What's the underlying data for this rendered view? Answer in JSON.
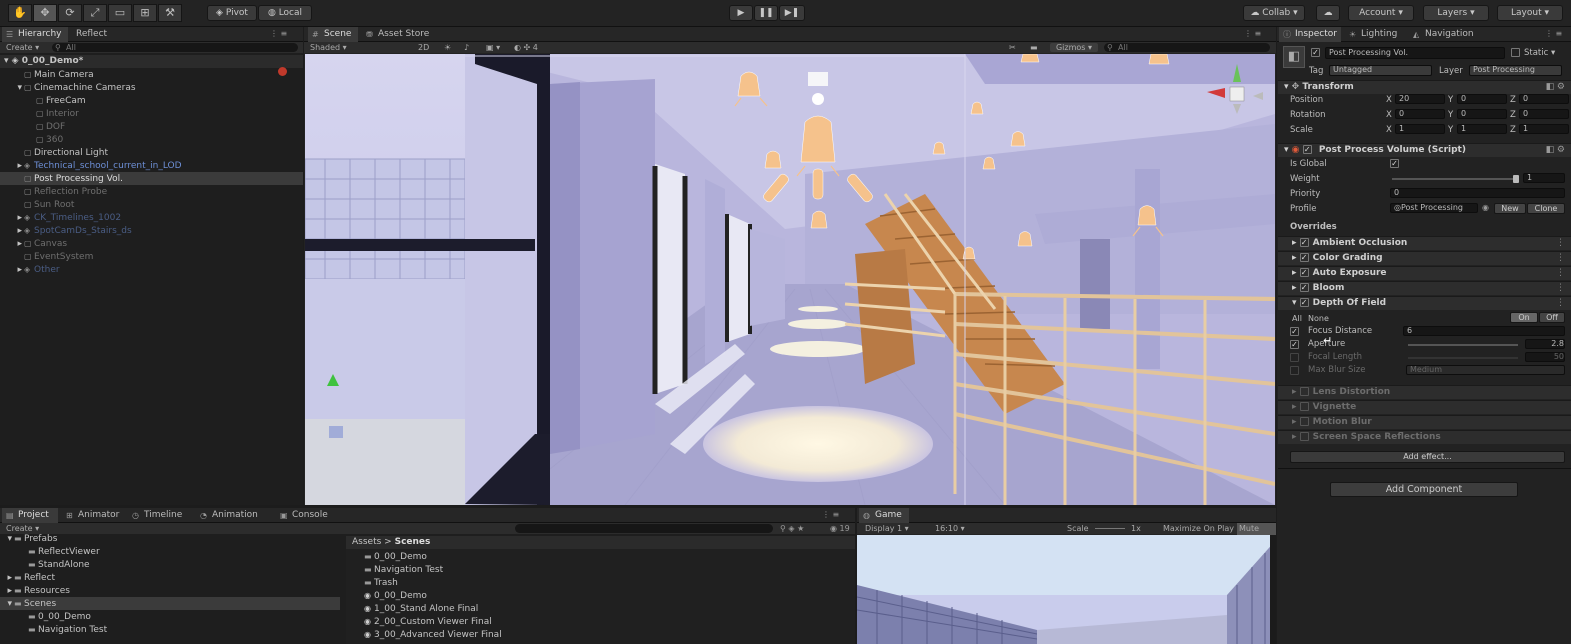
{
  "toolbar": {
    "tools": [
      "hand-tool",
      "move-tool",
      "rotate-tool",
      "scale-tool",
      "rect-tool",
      "transform-tool",
      "custom-tool"
    ],
    "pivot_label": "Pivot",
    "local_label": "Local",
    "play_icon": "▶",
    "pause_icon": "❚❚",
    "step_icon": "▶❚",
    "collab_label": "Collab",
    "account_label": "Account",
    "layers_label": "Layers",
    "layout_label": "Layout"
  },
  "hierarchy": {
    "tabs": [
      "Hierarchy",
      "Reflect"
    ],
    "create_label": "Create",
    "search_placeholder": "All",
    "scene_name": "0_00_Demo*",
    "items": [
      {
        "label": "Main Camera",
        "style": "normal",
        "indent": 2
      },
      {
        "label": "Cinemachine Cameras",
        "style": "normal",
        "indent": 2
      },
      {
        "label": "FreeCam",
        "style": "normal",
        "indent": 3
      },
      {
        "label": "Interior",
        "style": "dim",
        "indent": 3
      },
      {
        "label": "DOF",
        "style": "dim",
        "indent": 3
      },
      {
        "label": "360",
        "style": "dim",
        "indent": 3
      },
      {
        "label": "Directional Light",
        "style": "normal",
        "indent": 2
      },
      {
        "label": "Technical_school_current_in_LOD",
        "style": "blue",
        "indent": 2
      },
      {
        "label": "Post Processing Vol.",
        "style": "selected",
        "indent": 2
      },
      {
        "label": "Reflection Probe",
        "style": "dim",
        "indent": 2
      },
      {
        "label": "Sun Root",
        "style": "dim",
        "indent": 2
      },
      {
        "label": "CK_Timelines_1002",
        "style": "dimblue",
        "indent": 2
      },
      {
        "label": "SpotCamDs_Stairs_ds",
        "style": "dimblue",
        "indent": 2
      },
      {
        "label": "Canvas",
        "style": "dim",
        "indent": 2
      },
      {
        "label": "EventSystem",
        "style": "dim",
        "indent": 2
      },
      {
        "label": "Other",
        "style": "dimblue",
        "indent": 2
      }
    ]
  },
  "scene_view": {
    "tabs": [
      "Scene",
      "Asset Store"
    ],
    "shading_mode": "Shaded",
    "mode_2d": "2D",
    "gizmos_label": "Gizmos",
    "search_placeholder": "All"
  },
  "inspector": {
    "tabs": [
      "Inspector",
      "Lighting",
      "Navigation"
    ],
    "object_name": "Post Processing Vol.",
    "static_label": "Static",
    "tag_label": "Tag",
    "tag_value": "Untagged",
    "layer_label": "Layer",
    "layer_value": "Post Processing",
    "transform": {
      "title": "Transform",
      "rows": [
        {
          "label": "Position",
          "x": "20",
          "y": "0",
          "z": "0"
        },
        {
          "label": "Rotation",
          "x": "0",
          "y": "0",
          "z": "0"
        },
        {
          "label": "Scale",
          "x": "1",
          "y": "1",
          "z": "1"
        }
      ]
    },
    "ppv": {
      "title": "Post Process Volume (Script)",
      "is_global_label": "Is Global",
      "weight_label": "Weight",
      "weight_value": "1",
      "priority_label": "Priority",
      "priority_value": "0",
      "profile_label": "Profile",
      "profile_value": "Post Processing",
      "new_label": "New",
      "clone_label": "Clone",
      "overrides_label": "Overrides"
    },
    "effects": [
      {
        "label": "Ambient Occlusion",
        "enabled": true,
        "open": false
      },
      {
        "label": "Color Grading",
        "enabled": true,
        "open": false
      },
      {
        "label": "Auto Exposure",
        "enabled": true,
        "open": false
      },
      {
        "label": "Bloom",
        "enabled": true,
        "open": false
      },
      {
        "label": "Depth Of Field",
        "enabled": true,
        "open": true
      }
    ],
    "dof": {
      "all_label": "All",
      "none_label": "None",
      "on_label": "On",
      "off_label": "Off",
      "params": [
        {
          "label": "Focus Distance",
          "value": "6",
          "checked": true
        },
        {
          "label": "Aperture",
          "value": "2.8",
          "checked": true
        },
        {
          "label": "Focal Length",
          "value": "50",
          "checked": false
        },
        {
          "label": "Max Blur Size",
          "value": "Medium",
          "checked": false
        }
      ]
    },
    "disabled_effects": [
      "Lens Distortion",
      "Vignette",
      "Motion Blur",
      "Screen Space Reflections"
    ],
    "add_effect_label": "Add effect...",
    "add_component_label": "Add Component",
    "tool_marker": "↵"
  },
  "project": {
    "tabs": [
      "Project",
      "Animator",
      "Timeline",
      "Animation",
      "Console"
    ],
    "create_label": "Create",
    "tree": [
      {
        "label": "Prefabs",
        "indent": 1
      },
      {
        "label": "ReflectViewer",
        "indent": 2
      },
      {
        "label": "StandAlone",
        "indent": 2
      },
      {
        "label": "Reflect",
        "indent": 1
      },
      {
        "label": "Resources",
        "indent": 1
      },
      {
        "label": "Scenes",
        "indent": 1,
        "selected": true
      },
      {
        "label": "0_00_Demo",
        "indent": 2
      },
      {
        "label": "Navigation Test",
        "indent": 2
      }
    ],
    "breadcrumb_root": "Assets",
    "breadcrumb_sep": ">",
    "breadcrumb_current": "Scenes",
    "files": [
      {
        "label": "0_00_Demo",
        "kind": "folder"
      },
      {
        "label": "Navigation Test",
        "kind": "folder"
      },
      {
        "label": "Trash",
        "kind": "folder"
      },
      {
        "label": "0_00_Demo",
        "kind": "scene"
      },
      {
        "label": "1_00_Stand Alone Final",
        "kind": "scene"
      },
      {
        "label": "2_00_Custom Viewer Final",
        "kind": "scene"
      },
      {
        "label": "3_00_Advanced Viewer Final",
        "kind": "scene"
      }
    ],
    "slider_count": "19"
  },
  "game_view": {
    "tab": "Game",
    "display": "Display 1",
    "aspect": "16:10",
    "scale_label": "Scale",
    "scale_value": "1x",
    "maximize_label": "Maximize On Play",
    "mute_label": "Mute Audio"
  },
  "colors": {
    "accent_blue": "#4a6fb5",
    "editor_bg": "#232323",
    "panel_bg": "#1c1c1c",
    "lavender_scene": "#b8b5de",
    "wood": "#d79c62"
  }
}
